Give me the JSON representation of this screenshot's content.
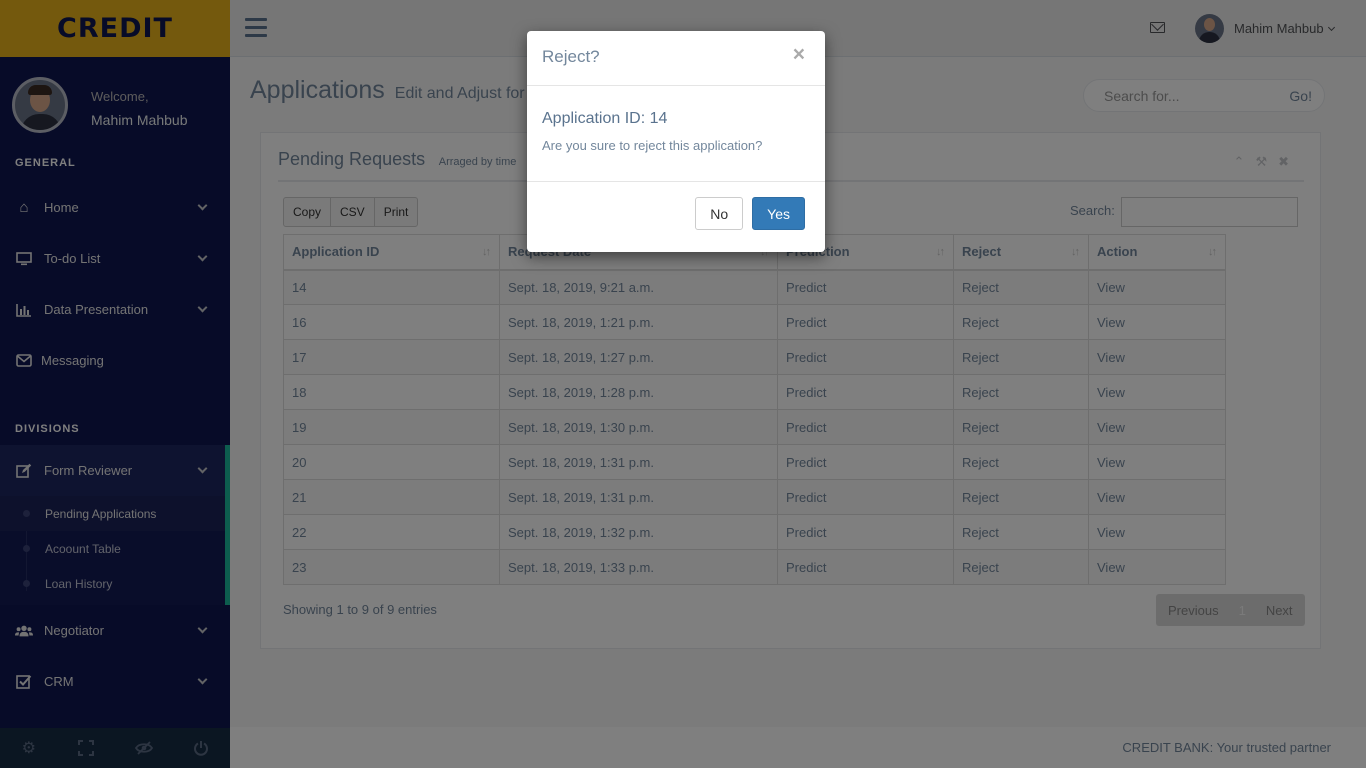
{
  "brand": "CREDIT",
  "profile": {
    "welcome": "Welcome,",
    "name": "Mahim Mahbub"
  },
  "sidebar": {
    "general_title": "GENERAL",
    "general": [
      {
        "label": "Home",
        "icon": "home-icon"
      },
      {
        "label": "To-do List",
        "icon": "desktop-icon"
      },
      {
        "label": "Data Presentation",
        "icon": "bar-chart-icon"
      },
      {
        "label": "Messaging",
        "icon": "envelope-icon"
      }
    ],
    "divisions_title": "DIVISIONS",
    "form_reviewer": "Form Reviewer",
    "submenu": [
      "Pending Applications",
      "Acoount Table",
      "Loan History"
    ],
    "negotiator": "Negotiator",
    "crm": "CRM"
  },
  "topbar": {
    "user": "Mahim Mahbub"
  },
  "page": {
    "title": "Applications",
    "subtitle": "Edit and Adjust for P"
  },
  "search": {
    "placeholder": "Search for...",
    "go": "Go!"
  },
  "panel": {
    "title": "Pending Requests",
    "subtitle": "Arraged by time",
    "buttons": [
      "Copy",
      "CSV",
      "Print"
    ],
    "search_label": "Search:"
  },
  "table": {
    "headers": [
      "Application ID",
      "Request Date",
      "Prediction",
      "Reject",
      "Action"
    ],
    "rows": [
      [
        "14",
        "Sept. 18, 2019, 9:21 a.m.",
        "Predict",
        "Reject",
        "View"
      ],
      [
        "16",
        "Sept. 18, 2019, 1:21 p.m.",
        "Predict",
        "Reject",
        "View"
      ],
      [
        "17",
        "Sept. 18, 2019, 1:27 p.m.",
        "Predict",
        "Reject",
        "View"
      ],
      [
        "18",
        "Sept. 18, 2019, 1:28 p.m.",
        "Predict",
        "Reject",
        "View"
      ],
      [
        "19",
        "Sept. 18, 2019, 1:30 p.m.",
        "Predict",
        "Reject",
        "View"
      ],
      [
        "20",
        "Sept. 18, 2019, 1:31 p.m.",
        "Predict",
        "Reject",
        "View"
      ],
      [
        "21",
        "Sept. 18, 2019, 1:31 p.m.",
        "Predict",
        "Reject",
        "View"
      ],
      [
        "22",
        "Sept. 18, 2019, 1:32 p.m.",
        "Predict",
        "Reject",
        "View"
      ],
      [
        "23",
        "Sept. 18, 2019, 1:33 p.m.",
        "Predict",
        "Reject",
        "View"
      ]
    ],
    "info": "Showing 1 to 9 of 9 entries",
    "pager": {
      "previous": "Previous",
      "page": "1",
      "next": "Next"
    }
  },
  "footer": "CREDIT BANK: Your trusted partner",
  "modal": {
    "title": "Reject?",
    "close": "×",
    "app_id": "Application ID: 14",
    "question": "Are you sure to reject this application?",
    "no": "No",
    "yes": "Yes"
  },
  "colors": {
    "sidebar": "#0e1650",
    "brand": "#e9b21b",
    "accent": "#1abb9c",
    "primary": "#337ab7"
  }
}
